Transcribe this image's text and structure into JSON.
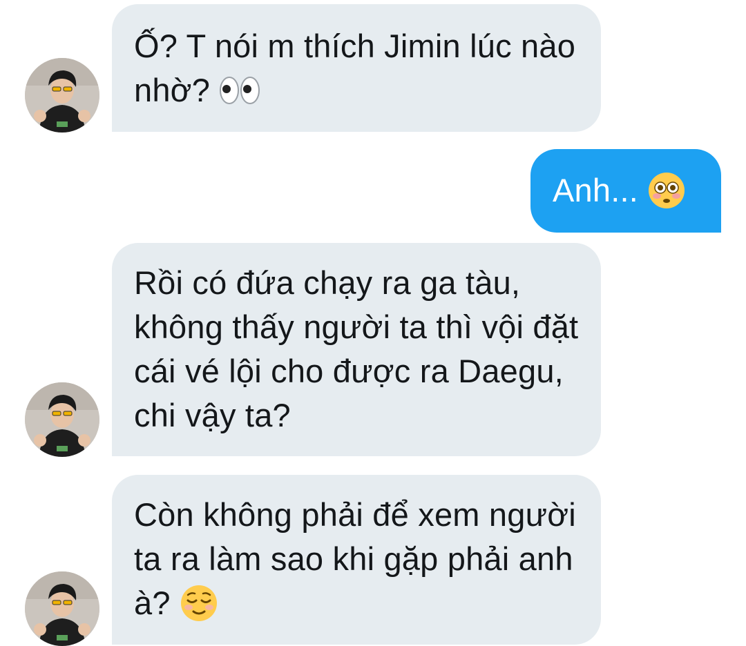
{
  "conversation": {
    "messages": [
      {
        "sender": "contact",
        "text": "Ố? T nói m thích Jimin lúc nào nhờ?",
        "emoji": "eyes-emoji"
      },
      {
        "sender": "me",
        "text": "Anh...",
        "emoji": "flushed-face-emoji"
      },
      {
        "sender": "contact",
        "text": "Rồi có đứa chạy ra ga tàu, không thấy người ta thì vội đặt cái vé lội cho được ra Daegu, chi vậy ta?"
      },
      {
        "sender": "contact",
        "text": "Còn không phải để xem người ta ra làm sao khi gặp phải anh à?",
        "emoji": "relieved-face-emoji"
      }
    ]
  },
  "colors": {
    "received_bubble": "#e6ecf0",
    "received_text": "#14171a",
    "sent_bubble": "#1da1f2",
    "sent_text": "#ffffff"
  }
}
